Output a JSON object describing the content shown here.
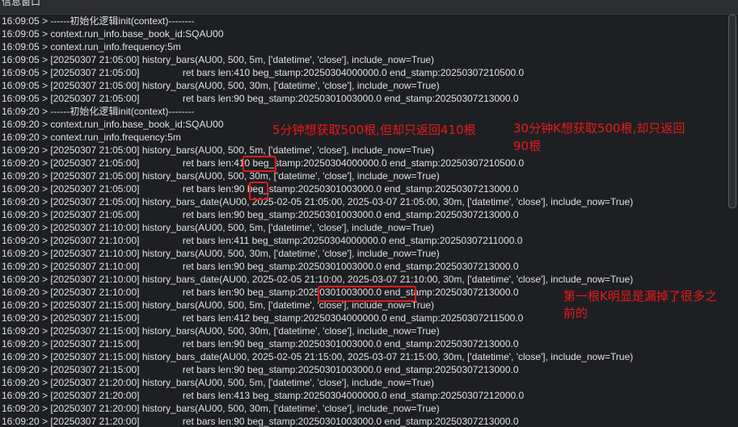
{
  "window": {
    "title": "信息窗口"
  },
  "log_lines": [
    "16:09:05 > ------初始化逻辑init(context)--------",
    "16:09:05 > context.run_info.base_book_id:SQAU00",
    "16:09:05 > context.run_info.frequency:5m",
    "16:09:05 > [20250307 21:05:00] history_bars(AU00, 500, 5m, ['datetime', 'close'], include_now=True)",
    "16:09:05 > [20250307 21:05:00]                ret bars len:410 beg_stamp:20250304000000.0 end_stamp:20250307210500.0",
    "16:09:05 > [20250307 21:05:00] history_bars(AU00, 500, 30m, ['datetime', 'close'], include_now=True)",
    "16:09:05 > [20250307 21:05:00]                ret bars len:90 beg_stamp:20250301003000.0 end_stamp:20250307213000.0",
    "16:09:20 > ------初始化逻辑init(context)--------",
    "16:09:20 > context.run_info.base_book_id:SQAU00",
    "16:09:20 > context.run_info.frequency:5m",
    "16:09:20 > [20250307 21:05:00] history_bars(AU00, 500, 5m, ['datetime', 'close'], include_now=True)",
    "16:09:20 > [20250307 21:05:00]                ret bars len:410 beg_stamp:20250304000000.0 end_stamp:20250307210500.0",
    "16:09:20 > [20250307 21:05:00] history_bars(AU00, 500, 30m, ['datetime', 'close'], include_now=True)",
    "16:09:20 > [20250307 21:05:00]                ret bars len:90 beg_stamp:20250301003000.0 end_stamp:20250307213000.0",
    "16:09:20 > [20250307 21:05:00] history_bars_date(AU00, 2025-02-05 21:05:00, 2025-03-07 21:05:00, 30m, ['datetime', 'close'], include_now=True)",
    "16:09:20 > [20250307 21:05:00]                ret bars len:90 beg_stamp:20250301003000.0 end_stamp:20250307213000.0",
    "16:09:20 > [20250307 21:10:00] history_bars(AU00, 500, 5m, ['datetime', 'close'], include_now=True)",
    "16:09:20 > [20250307 21:10:00]                ret bars len:411 beg_stamp:20250304000000.0 end_stamp:20250307211000.0",
    "16:09:20 > [20250307 21:10:00] history_bars(AU00, 500, 30m, ['datetime', 'close'], include_now=True)",
    "16:09:20 > [20250307 21:10:00]                ret bars len:90 beg_stamp:20250301003000.0 end_stamp:20250307213000.0",
    "16:09:20 > [20250307 21:10:00] history_bars_date(AU00, 2025-02-05 21:10:00, 2025-03-07 21:10:00, 30m, ['datetime', 'close'], include_now=True)",
    "16:09:20 > [20250307 21:10:00]                ret bars len:90 beg_stamp:20250301003000.0 end_stamp:20250307213000.0",
    "16:09:20 > [20250307 21:15:00] history_bars(AU00, 500, 5m, ['datetime', 'close'], include_now=True)",
    "16:09:20 > [20250307 21:15:00]                ret bars len:412 beg_stamp:20250304000000.0 end_stamp:20250307211500.0",
    "16:09:20 > [20250307 21:15:00] history_bars(AU00, 500, 30m, ['datetime', 'close'], include_now=True)",
    "16:09:20 > [20250307 21:15:00]                ret bars len:90 beg_stamp:20250301003000.0 end_stamp:20250307213000.0",
    "16:09:20 > [20250307 21:15:00] history_bars_date(AU00, 2025-02-05 21:15:00, 2025-03-07 21:15:00, 30m, ['datetime', 'close'], include_now=True)",
    "16:09:20 > [20250307 21:15:00]                ret bars len:90 beg_stamp:20250301003000.0 end_stamp:20250307213000.0",
    "16:09:20 > [20250307 21:20:00] history_bars(AU00, 500, 5m, ['datetime', 'close'], include_now=True)",
    "16:09:20 > [20250307 21:20:00]                ret bars len:413 beg_stamp:20250304000000.0 end_stamp:20250307212000.0",
    "16:09:20 > [20250307 21:20:00] history_bars(AU00, 500, 30m, ['datetime', 'close'], include_now=True)",
    "16:09:20 > [20250307 21:20:00]                ret bars len:90 beg_stamp:20250301003000.0 end_stamp:20250307213000.0"
  ],
  "annotations": {
    "note_5m": "5分钟想获取500根,但却只返回410根",
    "note_30m_line1": "30分钟K想获取500根,却只返回",
    "note_30m_line2": "90根",
    "note_first_k_line1": "第一根K明显是漏掉了很多之",
    "note_first_k_line2": "前的"
  },
  "colors": {
    "background": "#1e1f22",
    "text": "#dfe1e5",
    "annotation_red": "#e81a1a"
  }
}
